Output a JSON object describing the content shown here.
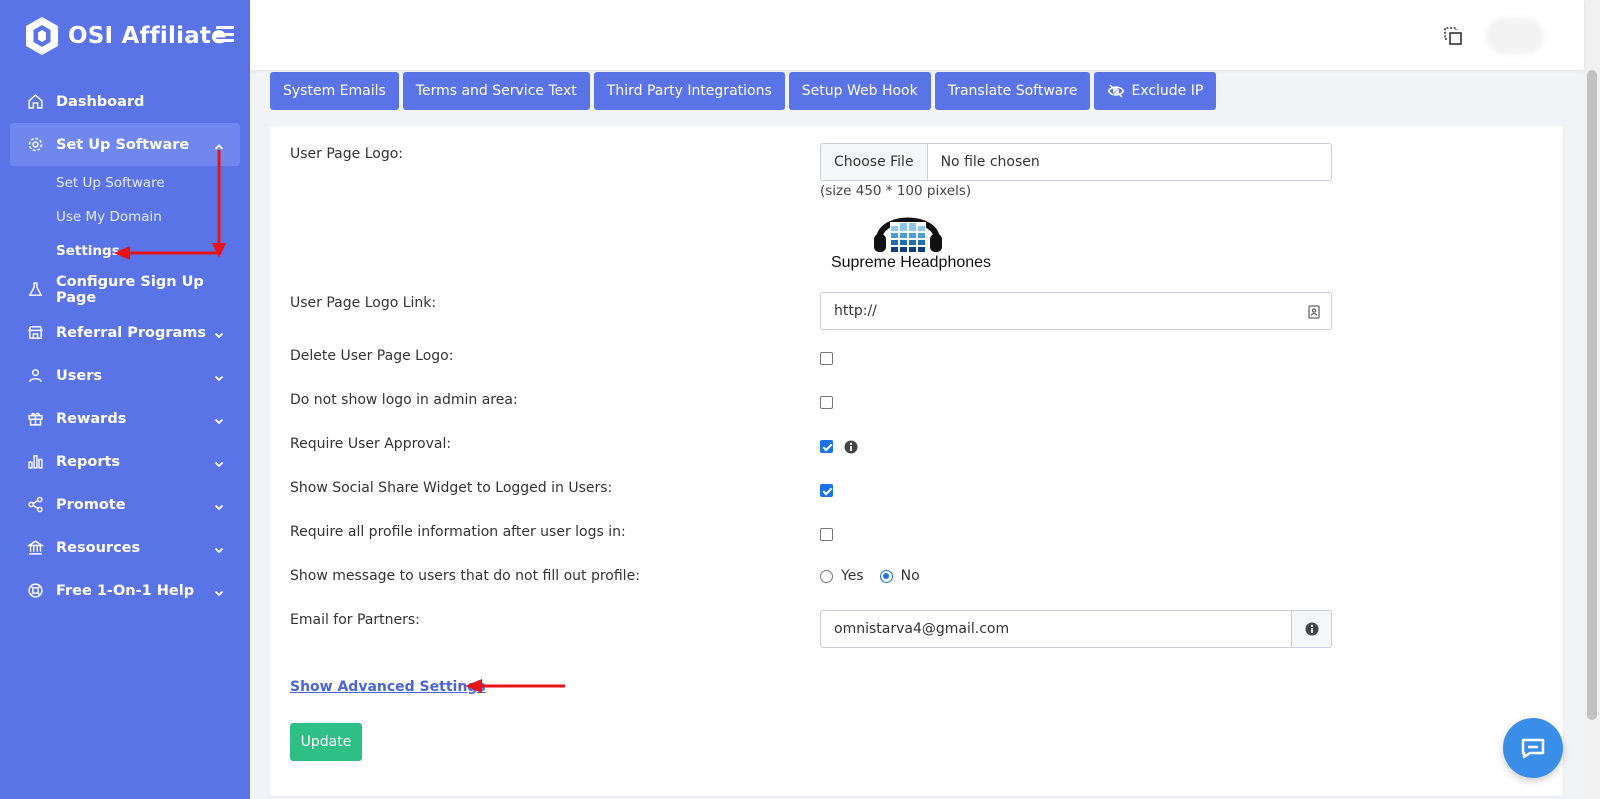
{
  "brand": {
    "name": "OSI Affiliate"
  },
  "sidebar": {
    "items": [
      {
        "label": "Dashboard",
        "icon": "home-icon"
      },
      {
        "label": "Set Up Software",
        "icon": "gear-icon",
        "expanded": true,
        "subitems": [
          {
            "label": "Set Up Software"
          },
          {
            "label": "Use My Domain"
          },
          {
            "label": "Settings",
            "current": true
          }
        ]
      },
      {
        "label": "Configure Sign Up Page",
        "icon": "flask-icon"
      },
      {
        "label": "Referral Programs",
        "icon": "store-icon"
      },
      {
        "label": "Users",
        "icon": "user-icon"
      },
      {
        "label": "Rewards",
        "icon": "gift-icon"
      },
      {
        "label": "Reports",
        "icon": "bar-chart-icon"
      },
      {
        "label": "Promote",
        "icon": "share-icon"
      },
      {
        "label": "Resources",
        "icon": "bank-icon"
      },
      {
        "label": "Free 1-On-1 Help",
        "icon": "lifebuoy-icon"
      }
    ]
  },
  "tabs": [
    {
      "label": "System Emails"
    },
    {
      "label": "Terms and Service Text"
    },
    {
      "label": "Third Party Integrations"
    },
    {
      "label": "Setup Web Hook"
    },
    {
      "label": "Translate Software"
    },
    {
      "label": "Exclude IP",
      "icon": "eye-slash-icon"
    }
  ],
  "form": {
    "logo": {
      "label": "User Page Logo:",
      "file_button": "Choose File",
      "file_status": "No file chosen",
      "size_hint": "(size 450 * 100 pixels)",
      "preview_caption": "Supreme Headphones"
    },
    "logo_link": {
      "label": "User Page Logo Link:",
      "value": "http://"
    },
    "delete_logo": {
      "label": "Delete User Page Logo:",
      "checked": false
    },
    "hide_admin_logo": {
      "label": "Do not show logo in admin area:",
      "checked": false
    },
    "require_approval": {
      "label": "Require User Approval:",
      "checked": true
    },
    "social_widget": {
      "label": "Show Social Share Widget to Logged in Users:",
      "checked": true
    },
    "require_profile": {
      "label": "Require all profile information after user logs in:",
      "checked": false
    },
    "profile_message": {
      "label": "Show message to users that do not fill out profile:",
      "yes": "Yes",
      "no": "No",
      "selected": "No"
    },
    "partner_email": {
      "label": "Email for Partners:",
      "value": "omnistarva4@gmail.com"
    },
    "advanced_link": "Show Advanced Settings",
    "update_button": "Update"
  },
  "colors": {
    "sidebar_bg": "#5a74e8",
    "tab_bg": "#5a74e8",
    "update_green": "#2ebf87",
    "annotation_red": "#e8141a",
    "chat_blue": "#3b8ee8"
  }
}
